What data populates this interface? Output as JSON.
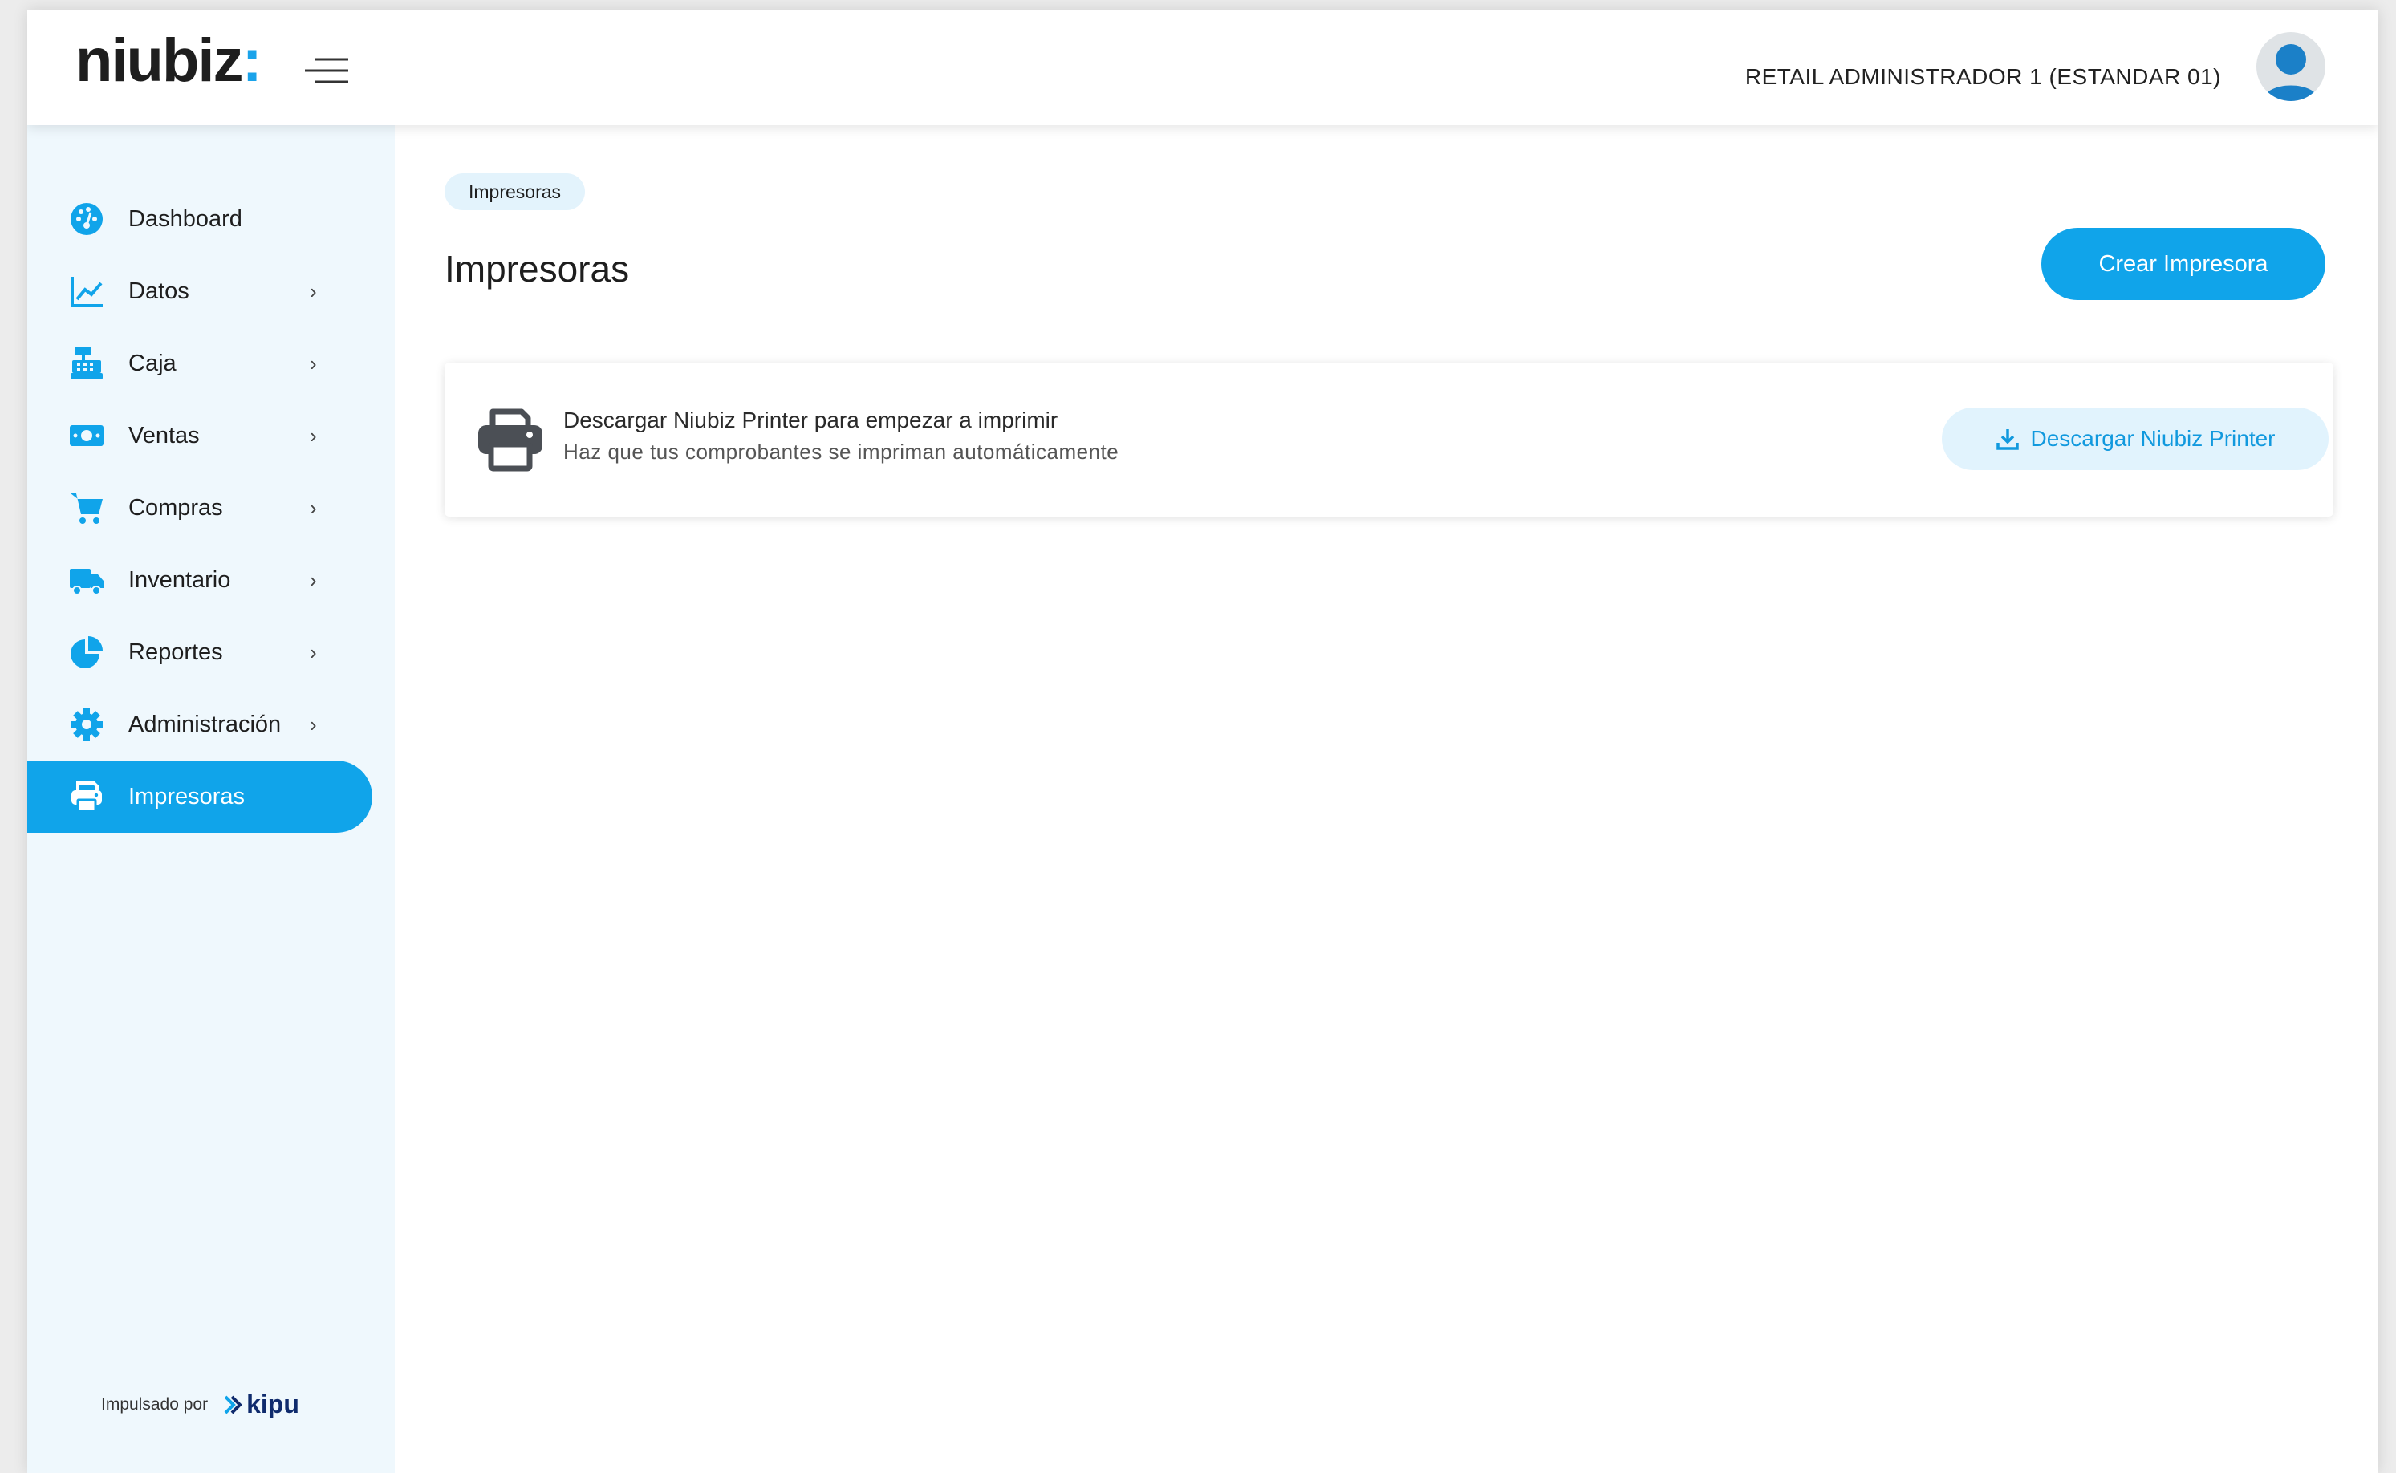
{
  "header": {
    "logo_text": "niubiz",
    "logo_colon": ":",
    "user_name": "RETAIL ADMINISTRADOR 1 (ESTANDAR 01)"
  },
  "sidebar": {
    "items": [
      {
        "label": "Dashboard",
        "icon": "dashboard-icon",
        "has_submenu": false,
        "active": false
      },
      {
        "label": "Datos",
        "icon": "chart-line-icon",
        "has_submenu": true,
        "active": false
      },
      {
        "label": "Caja",
        "icon": "cash-register-icon",
        "has_submenu": true,
        "active": false
      },
      {
        "label": "Ventas",
        "icon": "money-bill-icon",
        "has_submenu": true,
        "active": false
      },
      {
        "label": "Compras",
        "icon": "cart-icon",
        "has_submenu": true,
        "active": false
      },
      {
        "label": "Inventario",
        "icon": "truck-icon",
        "has_submenu": true,
        "active": false
      },
      {
        "label": "Reportes",
        "icon": "pie-chart-icon",
        "has_submenu": true,
        "active": false
      },
      {
        "label": "Administración",
        "icon": "gear-icon",
        "has_submenu": true,
        "active": false
      },
      {
        "label": "Impresoras",
        "icon": "printer-icon",
        "has_submenu": false,
        "active": true
      }
    ],
    "chevron": "›",
    "powered_by": "Impulsado por",
    "powered_brand": "kipu"
  },
  "main": {
    "breadcrumb": "Impresoras",
    "title": "Impresoras",
    "create_button": "Crear Impresora",
    "download_card": {
      "title": "Descargar Niubiz Printer para empezar a imprimir",
      "subtitle": "Haz que tus comprobantes se impriman automáticamente",
      "button": "Descargar Niubiz Printer"
    }
  },
  "colors": {
    "accent": "#10a4ea",
    "sidebar_bg": "#eff8fd",
    "kipu_brand": "#0f2b6d"
  }
}
